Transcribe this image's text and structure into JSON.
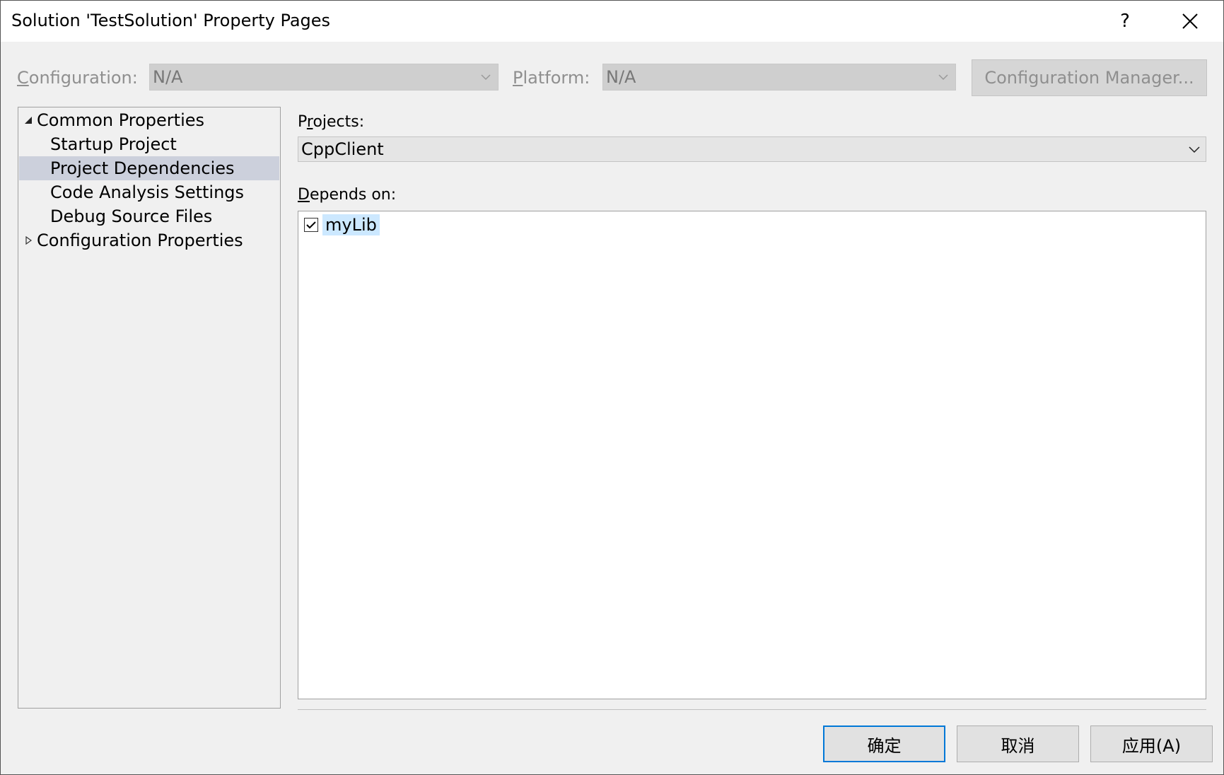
{
  "window": {
    "title": "Solution 'TestSolution' Property Pages",
    "help_label": "?"
  },
  "config_bar": {
    "configuration_label": "Configuration:",
    "configuration_value": "N/A",
    "platform_label": "Platform:",
    "platform_value": "N/A",
    "config_manager_label": "Configuration Manager..."
  },
  "tree": {
    "items": [
      {
        "label": "Common Properties",
        "expanded": true
      },
      {
        "label": "Startup Project"
      },
      {
        "label": "Project Dependencies",
        "selected": true
      },
      {
        "label": "Code Analysis Settings"
      },
      {
        "label": "Debug Source Files"
      },
      {
        "label": "Configuration Properties",
        "expanded": false
      }
    ]
  },
  "main": {
    "projects_label": "Projects:",
    "projects_value": "CppClient",
    "depends_label": "Depends on:",
    "depends_items": [
      {
        "label": "myLib",
        "checked": true
      }
    ]
  },
  "footer": {
    "ok_label": "确定",
    "cancel_label": "取消",
    "apply_label": "应用(A)"
  },
  "colors": {
    "selection": "#ccd0dc",
    "list_item_highlight": "#cce8ff",
    "default_button_border": "#0078d7"
  }
}
